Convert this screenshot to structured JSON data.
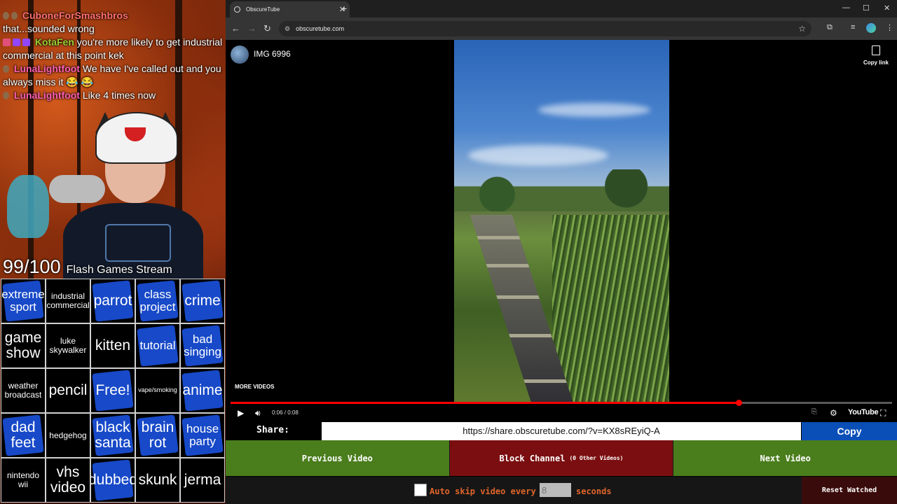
{
  "stream": {
    "chat": [
      {
        "user": "CuboneForSmashbros",
        "message": "",
        "color": "#ff6f6f"
      },
      {
        "user": "",
        "message": "that...sounded wrong"
      },
      {
        "user": "KotaFen",
        "message": "you're more likely to get industrial commercial at this point kek",
        "color": "#9acd32"
      },
      {
        "user": "LunaLightfoot",
        "message": "We have I've called out and you always miss it 😂 😂",
        "color": "#ff5fb0"
      },
      {
        "user": "LunaLightfoot",
        "message": "Like 4 times now",
        "color": "#ff5fb0"
      }
    ],
    "score": "99/100",
    "title": "Flash Games Stream",
    "bingo": [
      {
        "label": "extreme sport",
        "marked": true
      },
      {
        "label": "industrial commercial",
        "marked": false
      },
      {
        "label": "parrot",
        "marked": true
      },
      {
        "label": "class project",
        "marked": true
      },
      {
        "label": "crime",
        "marked": true
      },
      {
        "label": "game show",
        "marked": false
      },
      {
        "label": "luke skywalker",
        "marked": false
      },
      {
        "label": "kitten",
        "marked": false
      },
      {
        "label": "tutorial",
        "marked": true
      },
      {
        "label": "bad singing",
        "marked": true
      },
      {
        "label": "weather broadcast",
        "marked": false
      },
      {
        "label": "pencil",
        "marked": false
      },
      {
        "label": "Free!",
        "marked": true
      },
      {
        "label": "vape/smoking",
        "marked": false
      },
      {
        "label": "anime",
        "marked": true
      },
      {
        "label": "dad feet",
        "marked": true
      },
      {
        "label": "hedgehog",
        "marked": false
      },
      {
        "label": "black santa",
        "marked": true
      },
      {
        "label": "brain rot",
        "marked": true
      },
      {
        "label": "house party",
        "marked": true
      },
      {
        "label": "nintendo wii",
        "marked": false
      },
      {
        "label": "vhs video",
        "marked": false
      },
      {
        "label": "dubbed",
        "marked": true
      },
      {
        "label": "skunk",
        "marked": false
      },
      {
        "label": "jerma",
        "marked": false
      }
    ]
  },
  "browser": {
    "tab_title": "ObscureTube",
    "url": "obscuretube.com",
    "win_controls": [
      "—",
      "☐",
      "✕"
    ]
  },
  "video": {
    "channel_title": "IMG 6996",
    "copy_link_label": "Copy link",
    "more_videos_label": "MORE VIDEOS",
    "time": "0:06 / 0:08",
    "progress": 0.768,
    "youtube_label": "YouTube"
  },
  "share": {
    "label": "Share:",
    "url": "https://share.obscuretube.com/?v=KX8sREyiQ-A",
    "copy_label": "Copy"
  },
  "actions": {
    "previous": "Previous Video",
    "block": "Block Channel",
    "block_note": "(0 Other Videos)",
    "next": "Next Video"
  },
  "footer": {
    "auto_skip_label": "Auto skip video every",
    "seconds_placeholder": "8",
    "seconds_label": "seconds",
    "reset_label": "Reset Watched"
  },
  "colors": {
    "marked": "#1749c8",
    "green_button": "#4a7d1c",
    "red_button": "#7a0e10",
    "copy_button": "#0a4fb8",
    "progress": "#ff0000",
    "orange_text": "#e0642a"
  }
}
